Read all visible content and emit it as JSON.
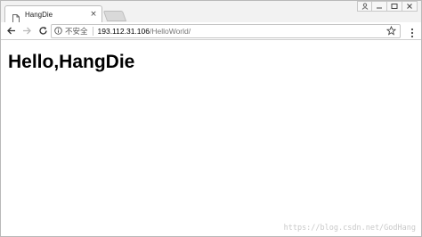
{
  "tab": {
    "title": "HangDie",
    "close_label": "×"
  },
  "address_bar": {
    "security_text": "不安全",
    "host": "193.112.31.106",
    "path": "/HelloWorld/"
  },
  "page": {
    "heading": "Hello,HangDie"
  },
  "watermark": "https://blog.csdn.net/GodHang",
  "colors": {
    "chrome_bg": "#f2f2f2",
    "tab_bg": "#ffffff",
    "border": "#bdbdbd",
    "url_path": "#777777",
    "watermark": "#c9c9c9"
  },
  "icons": [
    "page-icon",
    "close-icon",
    "back-arrow-icon",
    "forward-arrow-icon",
    "reload-icon",
    "info-icon",
    "star-icon",
    "menu-dots-icon",
    "user-icon",
    "minimize-icon",
    "maximize-icon",
    "window-close-icon"
  ]
}
